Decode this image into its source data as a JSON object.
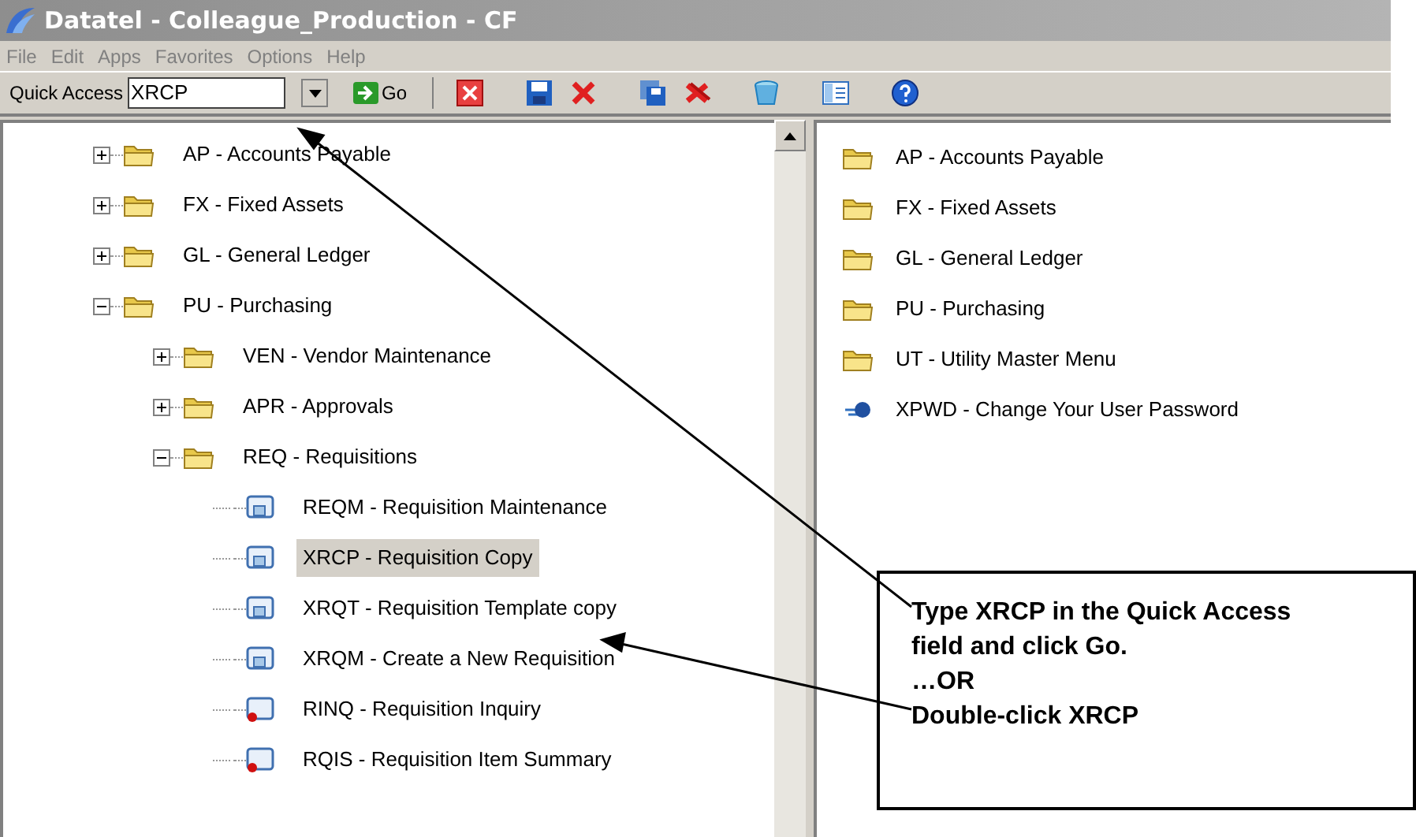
{
  "window": {
    "title": "Datatel - Colleague_Production - CF"
  },
  "menu": [
    "File",
    "Edit",
    "Apps",
    "Favorites",
    "Options",
    "Help"
  ],
  "toolbar": {
    "quick_access_label": "Quick Access",
    "quick_access_value": "XRCP",
    "go_label": "Go"
  },
  "tree": [
    {
      "label": "AP - Accounts Payable",
      "expanded": false,
      "selected": false
    },
    {
      "label": "FX - Fixed Assets",
      "expanded": false,
      "selected": false
    },
    {
      "label": "GL - General Ledger",
      "expanded": false,
      "selected": false
    },
    {
      "label": "PU - Purchasing",
      "expanded": true,
      "selected": false,
      "children": [
        {
          "label": "VEN - Vendor Maintenance",
          "expanded": false,
          "selected": false
        },
        {
          "label": "APR - Approvals",
          "expanded": false,
          "selected": false
        },
        {
          "label": "REQ - Requisitions",
          "expanded": true,
          "selected": false,
          "children": [
            {
              "label": "REQM - Requisition Maintenance",
              "kind": "form",
              "selected": false
            },
            {
              "label": "XRCP - Requisition Copy",
              "kind": "form",
              "selected": true
            },
            {
              "label": "XRQT - Requisition Template copy",
              "kind": "form",
              "selected": false
            },
            {
              "label": "XRQM - Create a New Requisition",
              "kind": "form",
              "selected": false
            },
            {
              "label": "RINQ - Requisition Inquiry",
              "kind": "inquiry",
              "selected": false
            },
            {
              "label": "RQIS - Requisition Item Summary",
              "kind": "inquiry",
              "selected": false
            }
          ]
        }
      ]
    }
  ],
  "favorites": [
    {
      "label": "AP - Accounts Payable",
      "kind": "folder"
    },
    {
      "label": "FX - Fixed Assets",
      "kind": "folder"
    },
    {
      "label": "GL - General Ledger",
      "kind": "folder"
    },
    {
      "label": "PU - Purchasing",
      "kind": "folder"
    },
    {
      "label": "UT - Utility Master Menu",
      "kind": "folder"
    },
    {
      "label": "XPWD - Change Your User Password",
      "kind": "process"
    }
  ],
  "callout": [
    "Type XRCP in the Quick Access field and click Go.",
    "…OR",
    "Double-click XRCP"
  ]
}
